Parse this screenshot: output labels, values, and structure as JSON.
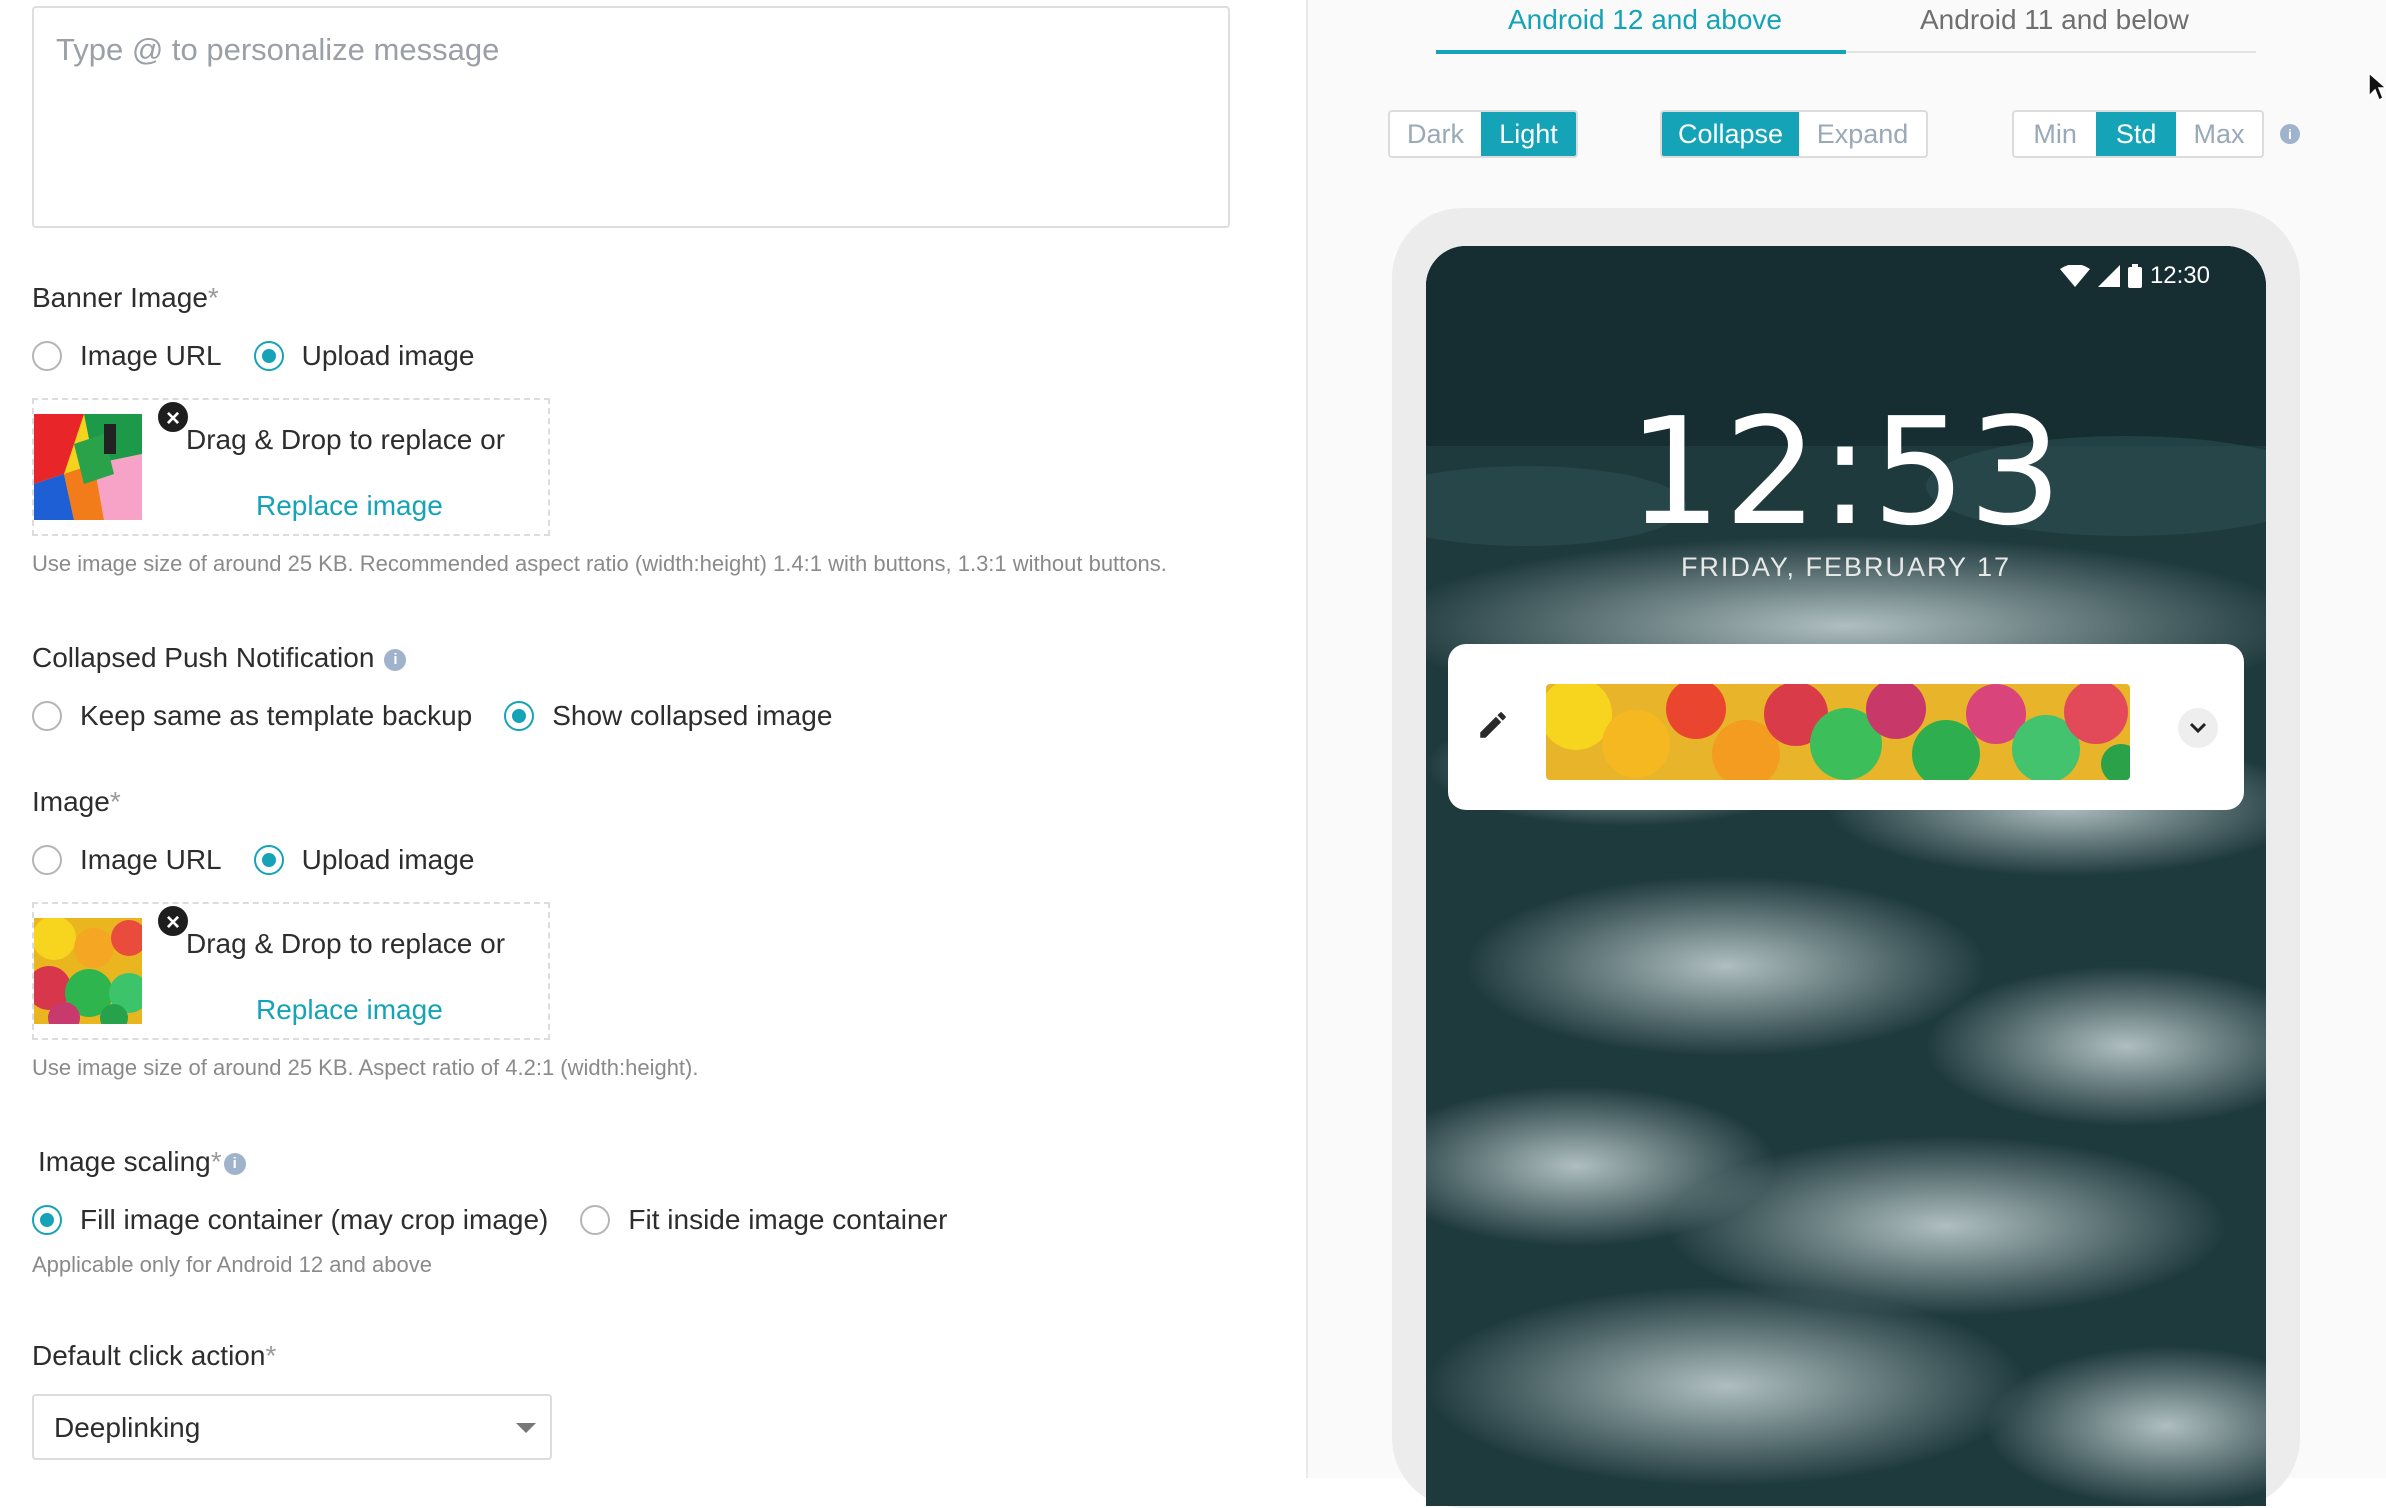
{
  "message": {
    "placeholder": "Type @ to personalize message"
  },
  "banner_image": {
    "label": "Banner Image",
    "required_mark": "*",
    "options": [
      "Image URL",
      "Upload image"
    ],
    "selected": "Upload image",
    "drag_text": "Drag & Drop to replace or",
    "replace_link": "Replace image",
    "help": "Use image size of around 25 KB. Recommended aspect ratio (width:height) 1.4:1 with buttons, 1.3:1 without buttons."
  },
  "collapsed_push": {
    "label": "Collapsed Push Notification",
    "info_icon": "info-icon",
    "options": [
      "Keep same as template backup",
      "Show collapsed image"
    ],
    "selected": "Show collapsed image"
  },
  "image": {
    "label": "Image",
    "required_mark": "*",
    "options": [
      "Image URL",
      "Upload image"
    ],
    "selected": "Upload image",
    "drag_text": "Drag & Drop to replace or",
    "replace_link": "Replace image",
    "help": "Use image size of around 25 KB. Aspect ratio of 4.2:1 (width:height)."
  },
  "image_scaling": {
    "label": "Image scaling",
    "required_mark": "*",
    "options": [
      "Fill image container (may crop image)",
      "Fit inside image container"
    ],
    "selected": "Fill image container (may crop image)",
    "help": "Applicable only for Android 12 and above"
  },
  "default_click": {
    "label": "Default click action",
    "required_mark": "*",
    "value": "Deeplinking"
  },
  "preview": {
    "tabs": [
      "Android 12 and above",
      "Android 11 and below"
    ],
    "active_tab": "Android 12 and above",
    "theme": {
      "options": [
        "Dark",
        "Light"
      ],
      "selected": "Light"
    },
    "state": {
      "options": [
        "Collapse",
        "Expand"
      ],
      "selected": "Collapse"
    },
    "size": {
      "options": [
        "Min",
        "Std",
        "Max"
      ],
      "selected": "Std"
    },
    "phone": {
      "status_time": "12:30",
      "clock": "12:53",
      "date": "FRIDAY, FEBRUARY 17"
    }
  },
  "colors": {
    "accent": "#15a3b8",
    "muted": "#9aa9b8"
  }
}
